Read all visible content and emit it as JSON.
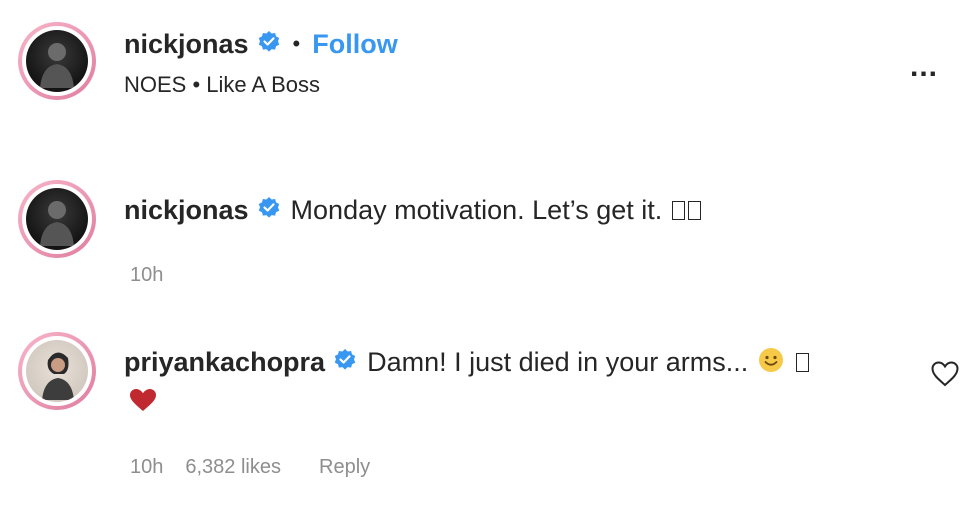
{
  "header": {
    "username": "nickjonas",
    "follow_label": "Follow",
    "separator": "•",
    "subtitle": "NOES • Like A Boss",
    "more_label": "..."
  },
  "caption": {
    "username": "nickjonas",
    "text": "Monday motivation. Let’s get it.",
    "time": "10h"
  },
  "comment": {
    "username": "priyankachopra",
    "text": "Damn! I just died in your arms...",
    "time": "10h",
    "likes": "6,382 likes",
    "reply_label": "Reply"
  },
  "colors": {
    "link": "#3897f0",
    "verified": "#3897f0",
    "heart": "#ed4956",
    "muted": "#8e8e8e"
  },
  "icons": [
    "verified-badge-icon",
    "more-options-icon",
    "like-heart-icon",
    "red-heart-emoji",
    "smiling-emoji"
  ]
}
